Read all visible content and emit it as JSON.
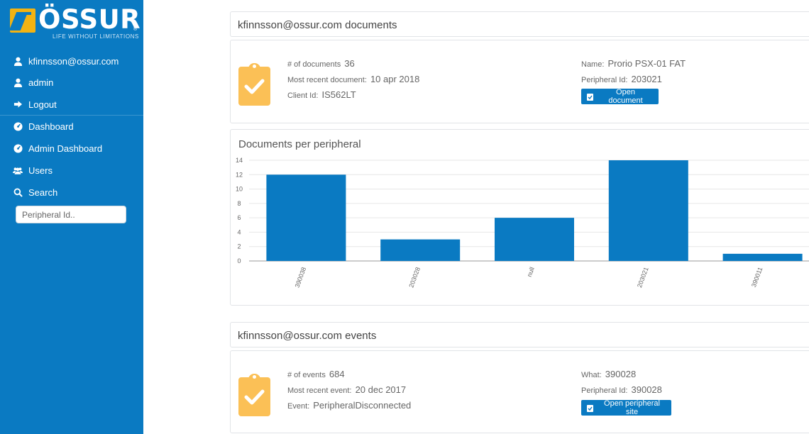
{
  "sidebar": {
    "logo": {
      "brand": "ÖSSUR",
      "tagline": "LIFE WITHOUT LIMITATIONS",
      "registered": "®"
    },
    "items": [
      {
        "label": "kfinnsson@ossur.com",
        "icon": "user-icon"
      },
      {
        "label": "admin",
        "icon": "user-icon"
      },
      {
        "label": "Logout",
        "icon": "logout-icon"
      },
      {
        "label": "Dashboard",
        "icon": "dashboard-icon"
      },
      {
        "label": "Admin Dashboard",
        "icon": "dashboard-icon"
      },
      {
        "label": "Users",
        "icon": "users-icon"
      },
      {
        "label": "Search",
        "icon": "search-icon"
      }
    ],
    "search": {
      "placeholder": "Peripheral Id.."
    }
  },
  "documents": {
    "header": "kfinnsson@ossur.com documents",
    "count_label": "# of documents",
    "count_value": "36",
    "recent_label": "Most recent document:",
    "recent_value": "10 apr 2018",
    "client_label": "Client Id:",
    "client_value": "IS562LT",
    "name_label": "Name:",
    "name_value": "Prorio PSX-01 FAT",
    "peripheral_label": "Peripheral Id:",
    "peripheral_value": "203021",
    "button_label": "Open document"
  },
  "events": {
    "header": "kfinnsson@ossur.com events",
    "count_label": "# of events",
    "count_value": "684",
    "recent_label": "Most recent event:",
    "recent_value": "20 dec 2017",
    "event_label": "Event:",
    "event_value": "PeripheralDisconnected",
    "what_label": "What:",
    "what_value": "390028",
    "peripheral_label": "Peripheral Id:",
    "peripheral_value": "390028",
    "button_label": "Open peripheral site"
  },
  "colors": {
    "sidebar": "#0a7ac2",
    "bar": "#0a7ac2",
    "accent": "#fbc056"
  },
  "chart_data": {
    "type": "bar",
    "title": "Documents per peripheral",
    "categories": [
      "390038",
      "203028",
      "null",
      "203021",
      "390011"
    ],
    "values": [
      12,
      3,
      6,
      14,
      1
    ],
    "yticks": [
      "0",
      "2",
      "4",
      "6",
      "8",
      "10",
      "12",
      "14"
    ],
    "ylim": [
      0,
      14
    ],
    "grid": true
  }
}
